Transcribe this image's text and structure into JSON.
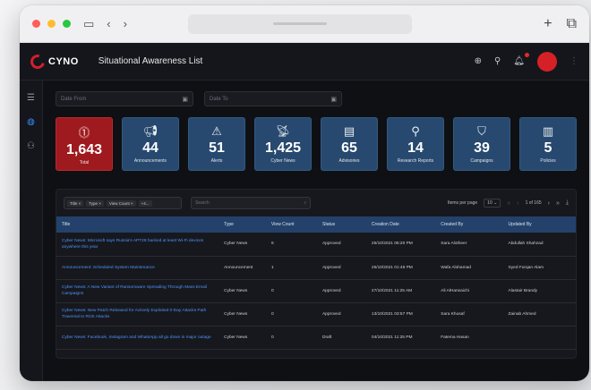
{
  "app": {
    "logo_text": "CYNO",
    "page_title": "Situational Awareness List"
  },
  "filters": {
    "start_placeholder": "Date From",
    "end_placeholder": "Date To"
  },
  "cards": [
    {
      "value": "1,643",
      "label": "Total",
      "icon": "total-icon"
    },
    {
      "value": "44",
      "label": "Announcements",
      "icon": "megaphone-icon"
    },
    {
      "value": "51",
      "label": "Alerts",
      "icon": "alert-icon"
    },
    {
      "value": "1,425",
      "label": "Cyber News",
      "icon": "antenna-icon"
    },
    {
      "value": "65",
      "label": "Advisories",
      "icon": "document-icon"
    },
    {
      "value": "14",
      "label": "Research Reports",
      "icon": "magnifier-icon"
    },
    {
      "value": "39",
      "label": "Campaigns",
      "icon": "bookmark-icon"
    },
    {
      "value": "5",
      "label": "Policies",
      "icon": "policy-icon"
    }
  ],
  "table": {
    "chips": [
      "Title ×",
      "Type ×",
      "View Count ×",
      "+4..."
    ],
    "search_placeholder": "Search",
    "items_per_page_label": "Items per page",
    "items_per_page_value": "10 ⌄",
    "range_text": "1 of 165",
    "columns": [
      "Title",
      "Type",
      "View Count",
      "Status",
      "Creation Date",
      "Created By",
      "Updated By"
    ],
    "rows": [
      {
        "title": "Cyber News: Microsoft says Russia's APT28 hacked at least Wi-Fi devices anywhere this year",
        "type": "Cyber News",
        "views": "6",
        "status": "Approved",
        "date": "25/10/2021 05:20 PM",
        "created_by": "Sara Alotheer",
        "updated_by": "Abdullah Shahzad"
      },
      {
        "title": "Announcement: Scheduled System Maintenance",
        "type": "Announcement",
        "views": "1",
        "status": "Approved",
        "date": "25/10/2021 01:48 PM",
        "created_by": "Wafa Alohamad",
        "updated_by": "Syed Furqan Alam"
      },
      {
        "title": "Cyber News: A New Variant of Ransomware Spreading Through Mass Email Campaigns",
        "type": "Cyber News",
        "views": "0",
        "status": "Approved",
        "date": "27/10/2021 11:25 AM",
        "created_by": "Ali AlHarwaichi",
        "updated_by": "Alastair Brandy"
      },
      {
        "title": "Cyber News: New Patch Released for Actively Exploited 0-Day Attacks Path Traversal to RCE Attacks",
        "type": "Cyber News",
        "views": "0",
        "status": "Approved",
        "date": "13/10/2021 03:57 PM",
        "created_by": "Sara Khusaf",
        "updated_by": "Zainab Ahmed"
      },
      {
        "title": "Cyber News: Facebook, Instagram and WhatsApp all go down in major outage",
        "type": "Cyber News",
        "views": "0",
        "status": "Draft",
        "date": "04/10/2021 11:25 PM",
        "created_by": "Fatema Hasan",
        "updated_by": ""
      }
    ]
  }
}
